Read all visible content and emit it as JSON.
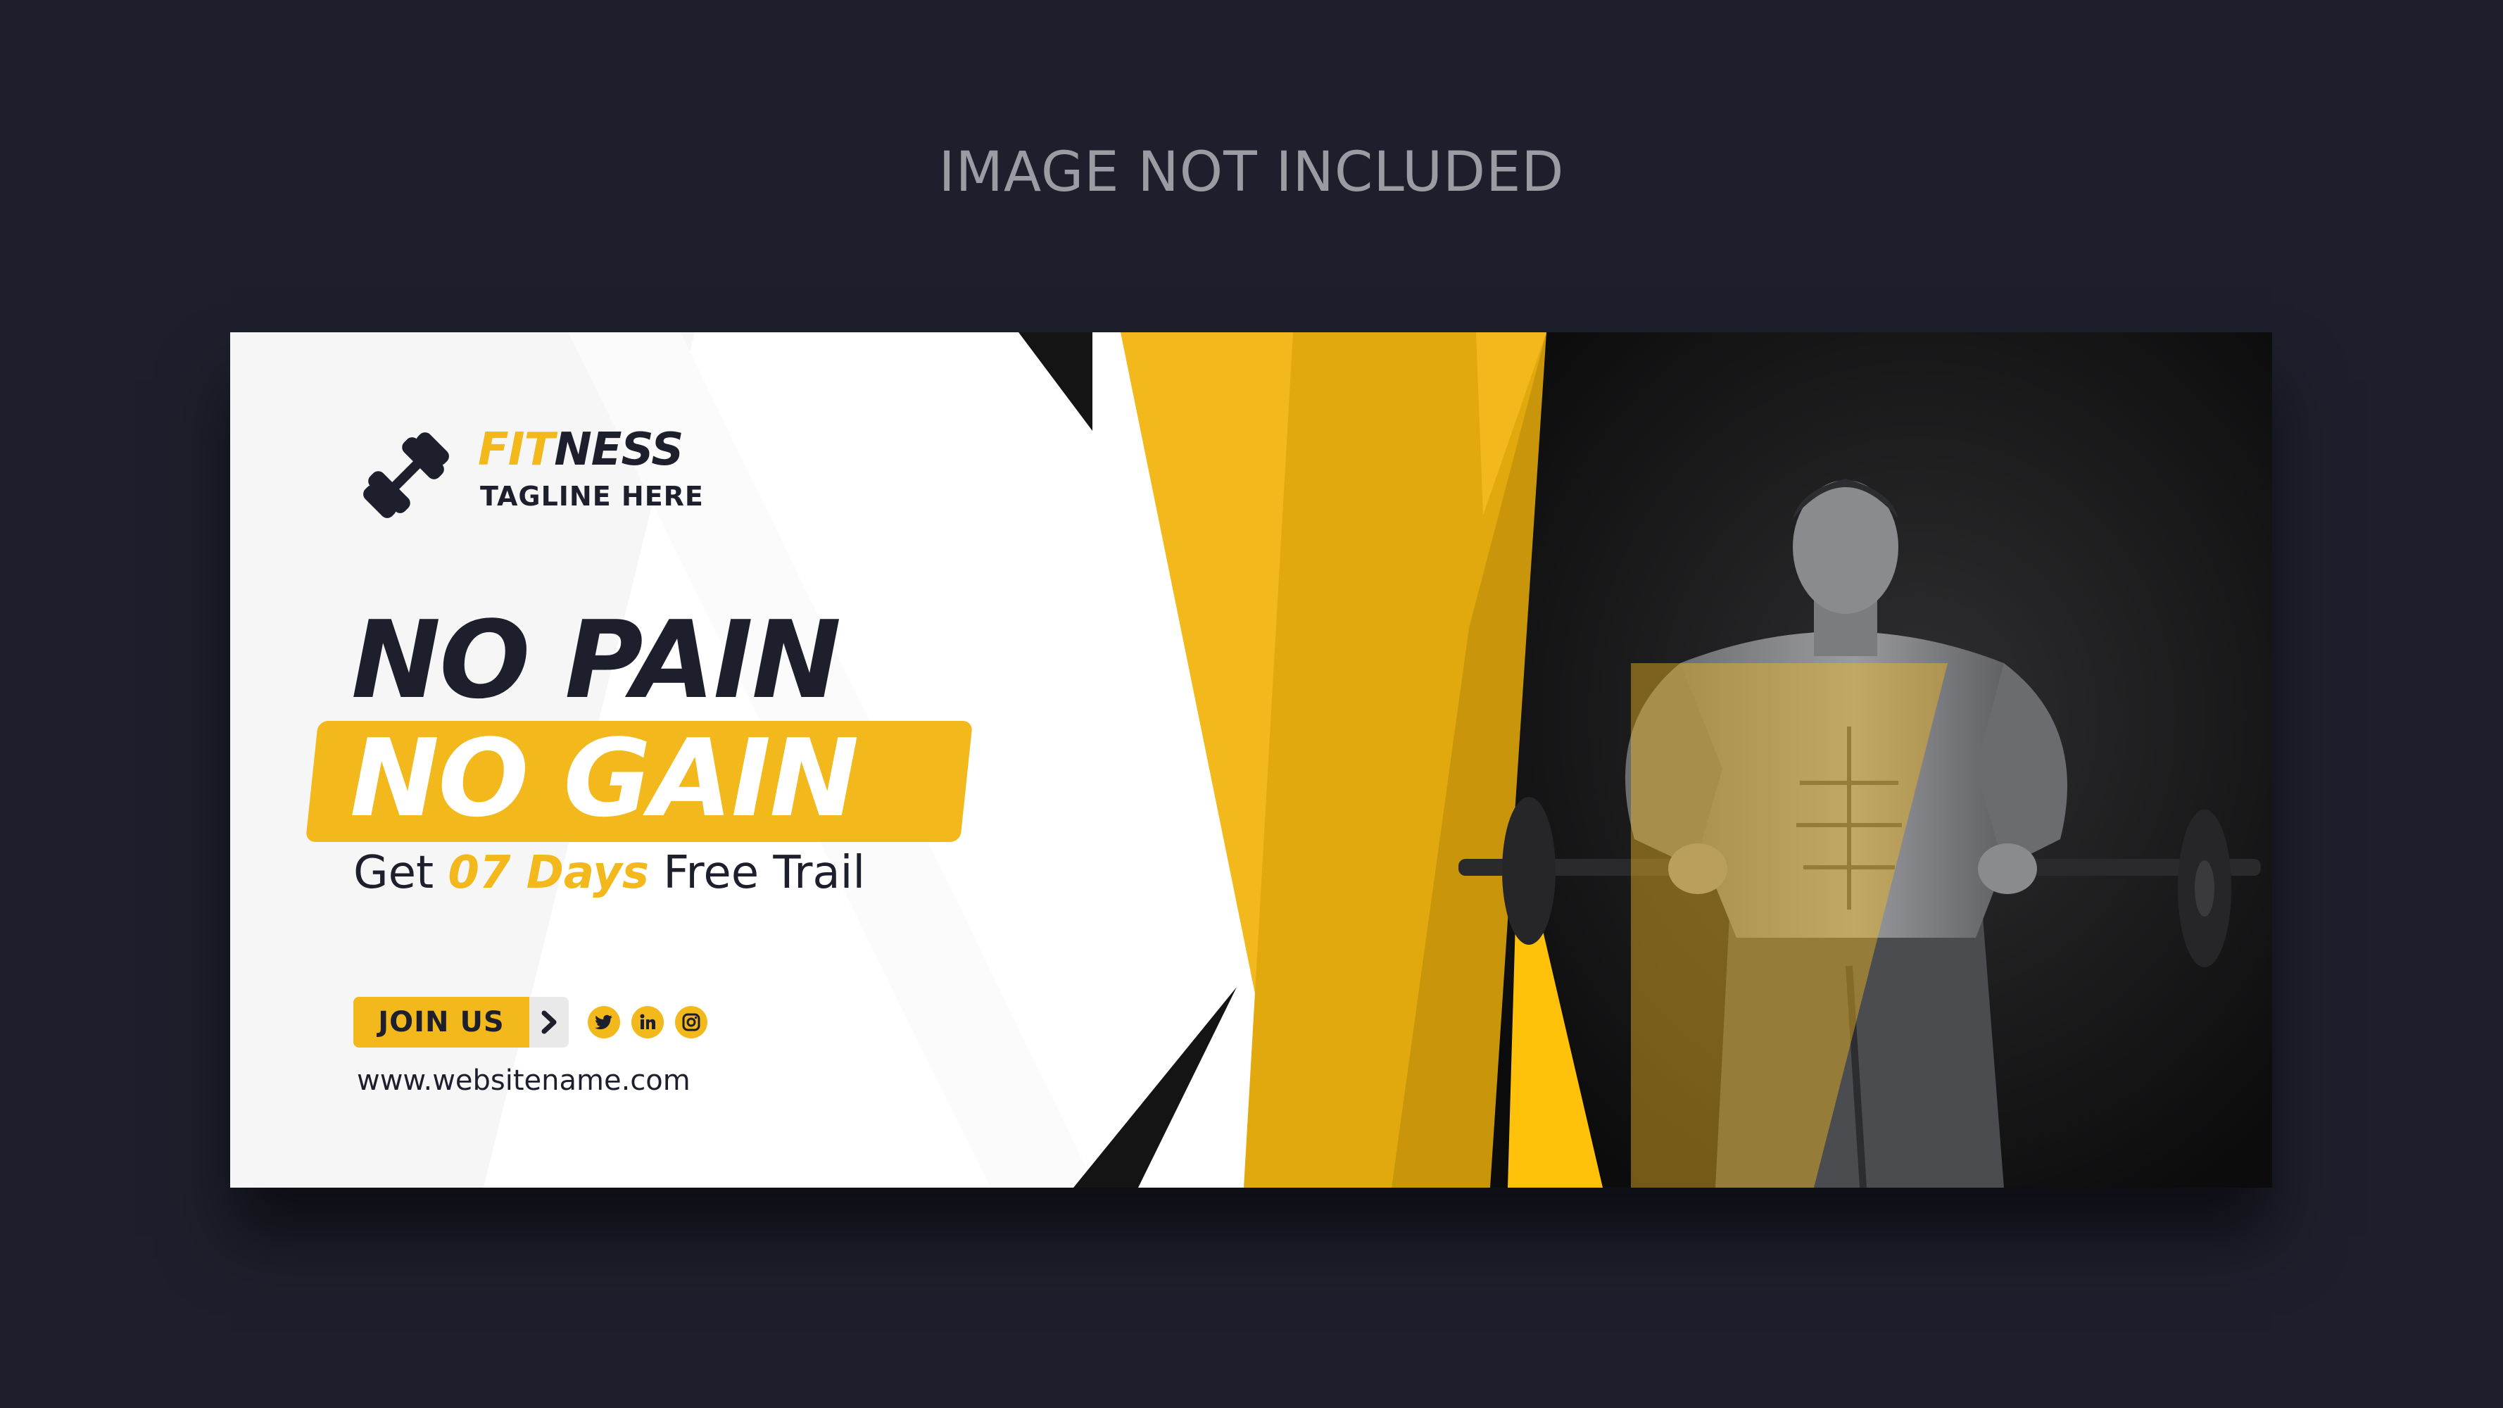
{
  "notice": "IMAGE NOT INCLUDED",
  "brand": {
    "name_part_1": "FIT",
    "name_part_2": "NESS",
    "tagline": "TAGLINE HERE",
    "logo_icon": "dumbbell-icon"
  },
  "headline": {
    "line_1": "NO PAIN",
    "line_2": "NO GAIN"
  },
  "offer": {
    "prefix": "Get ",
    "highlight": "07 Days",
    "suffix": " Free Trail"
  },
  "cta": {
    "label": "JOIN US",
    "arrow_icon": "chevron-right-icon"
  },
  "social": [
    "twitter-icon",
    "linkedin-icon",
    "instagram-icon"
  ],
  "website": "www.websitename.com",
  "colors": {
    "background": "#1d1f2c",
    "accent": "#f2b81c",
    "dark": "#1d1f2c",
    "banner_white": "#ffffff"
  }
}
